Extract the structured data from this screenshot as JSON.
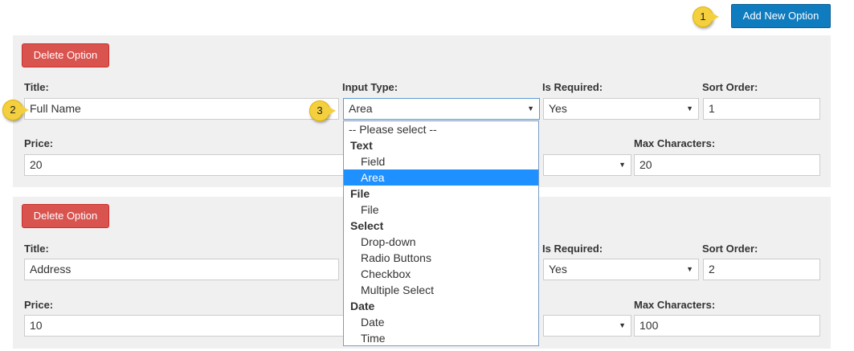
{
  "toolbar": {
    "add_button": "Add New Option"
  },
  "callouts": [
    "1",
    "2",
    "3"
  ],
  "options": [
    {
      "delete_label": "Delete Option",
      "labels": {
        "title": "Title:",
        "input_type": "Input Type:",
        "is_required": "Is Required:",
        "sort_order": "Sort Order:",
        "price": "Price:",
        "max_chars": "Max Characters:"
      },
      "title_value": "Full Name",
      "input_type_value": "Area",
      "is_required_value": "Yes",
      "sort_order_value": "1",
      "price_value": "20",
      "max_chars_value": "20"
    },
    {
      "delete_label": "Delete Option",
      "labels": {
        "title": "Title:",
        "is_required": "Is Required:",
        "sort_order": "Sort Order:",
        "price": "Price:",
        "max_chars": "Max Characters:"
      },
      "title_value": "Address",
      "is_required_value": "Yes",
      "sort_order_value": "2",
      "price_value": "10",
      "max_chars_value": "100"
    }
  ],
  "dropdown": {
    "placeholder": "-- Please select --",
    "groups": [
      "Text",
      "File",
      "Select",
      "Date"
    ],
    "options": [
      "Field",
      "Area",
      "File",
      "Drop-down",
      "Radio Buttons",
      "Checkbox",
      "Multiple Select",
      "Date",
      "Time"
    ],
    "selected": "Area"
  },
  "colors": {
    "primary": "#0f7cc0",
    "danger": "#d9534f",
    "highlight": "#1e90ff",
    "callout": "#f4d03f",
    "panel": "#f0f0f0"
  }
}
